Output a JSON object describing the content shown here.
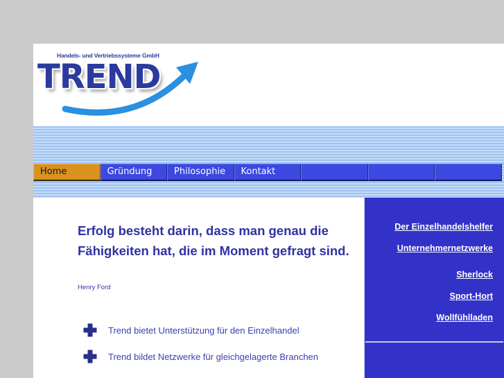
{
  "logo": {
    "tagline": "Handels- und Vertriebssysteme GmbH",
    "wordmark": "TREND",
    "arrow_icon": "upward-swoosh-arrow-icon"
  },
  "nav": {
    "tabs": [
      {
        "label": "Home",
        "active": true
      },
      {
        "label": "Gründung",
        "active": false
      },
      {
        "label": "Philosophie",
        "active": false
      },
      {
        "label": "Kontakt",
        "active": false
      },
      {
        "label": "",
        "active": false
      },
      {
        "label": "",
        "active": false
      },
      {
        "label": "",
        "active": false
      }
    ]
  },
  "main": {
    "quote": "Erfolg besteht darin, dass man genau die Fähigkeiten hat, die im Moment gefragt sind.",
    "author": "Henry Ford",
    "bullets": [
      {
        "icon": "plus-icon",
        "text": "Trend bietet Unterstützung für den Einzelhandel"
      },
      {
        "icon": "plus-icon",
        "text": "Trend bildet Netzwerke für gleichgelagerte Branchen"
      }
    ]
  },
  "sidebar": {
    "links": [
      "Der Einzelhandelshelfer",
      "Unternehmernetzwerke",
      "Sherlock",
      "Sport-Hort",
      "Wollfühlladen"
    ]
  },
  "colors": {
    "page_bg": "#cbcbcb",
    "nav_tab": "#3d48e0",
    "nav_tab_active": "#d9921e",
    "sidebar_bg": "#3232c8",
    "text_primary": "#2e33a0",
    "stripe_dark": "#9ec2f2",
    "stripe_light": "#c8dcf8"
  }
}
